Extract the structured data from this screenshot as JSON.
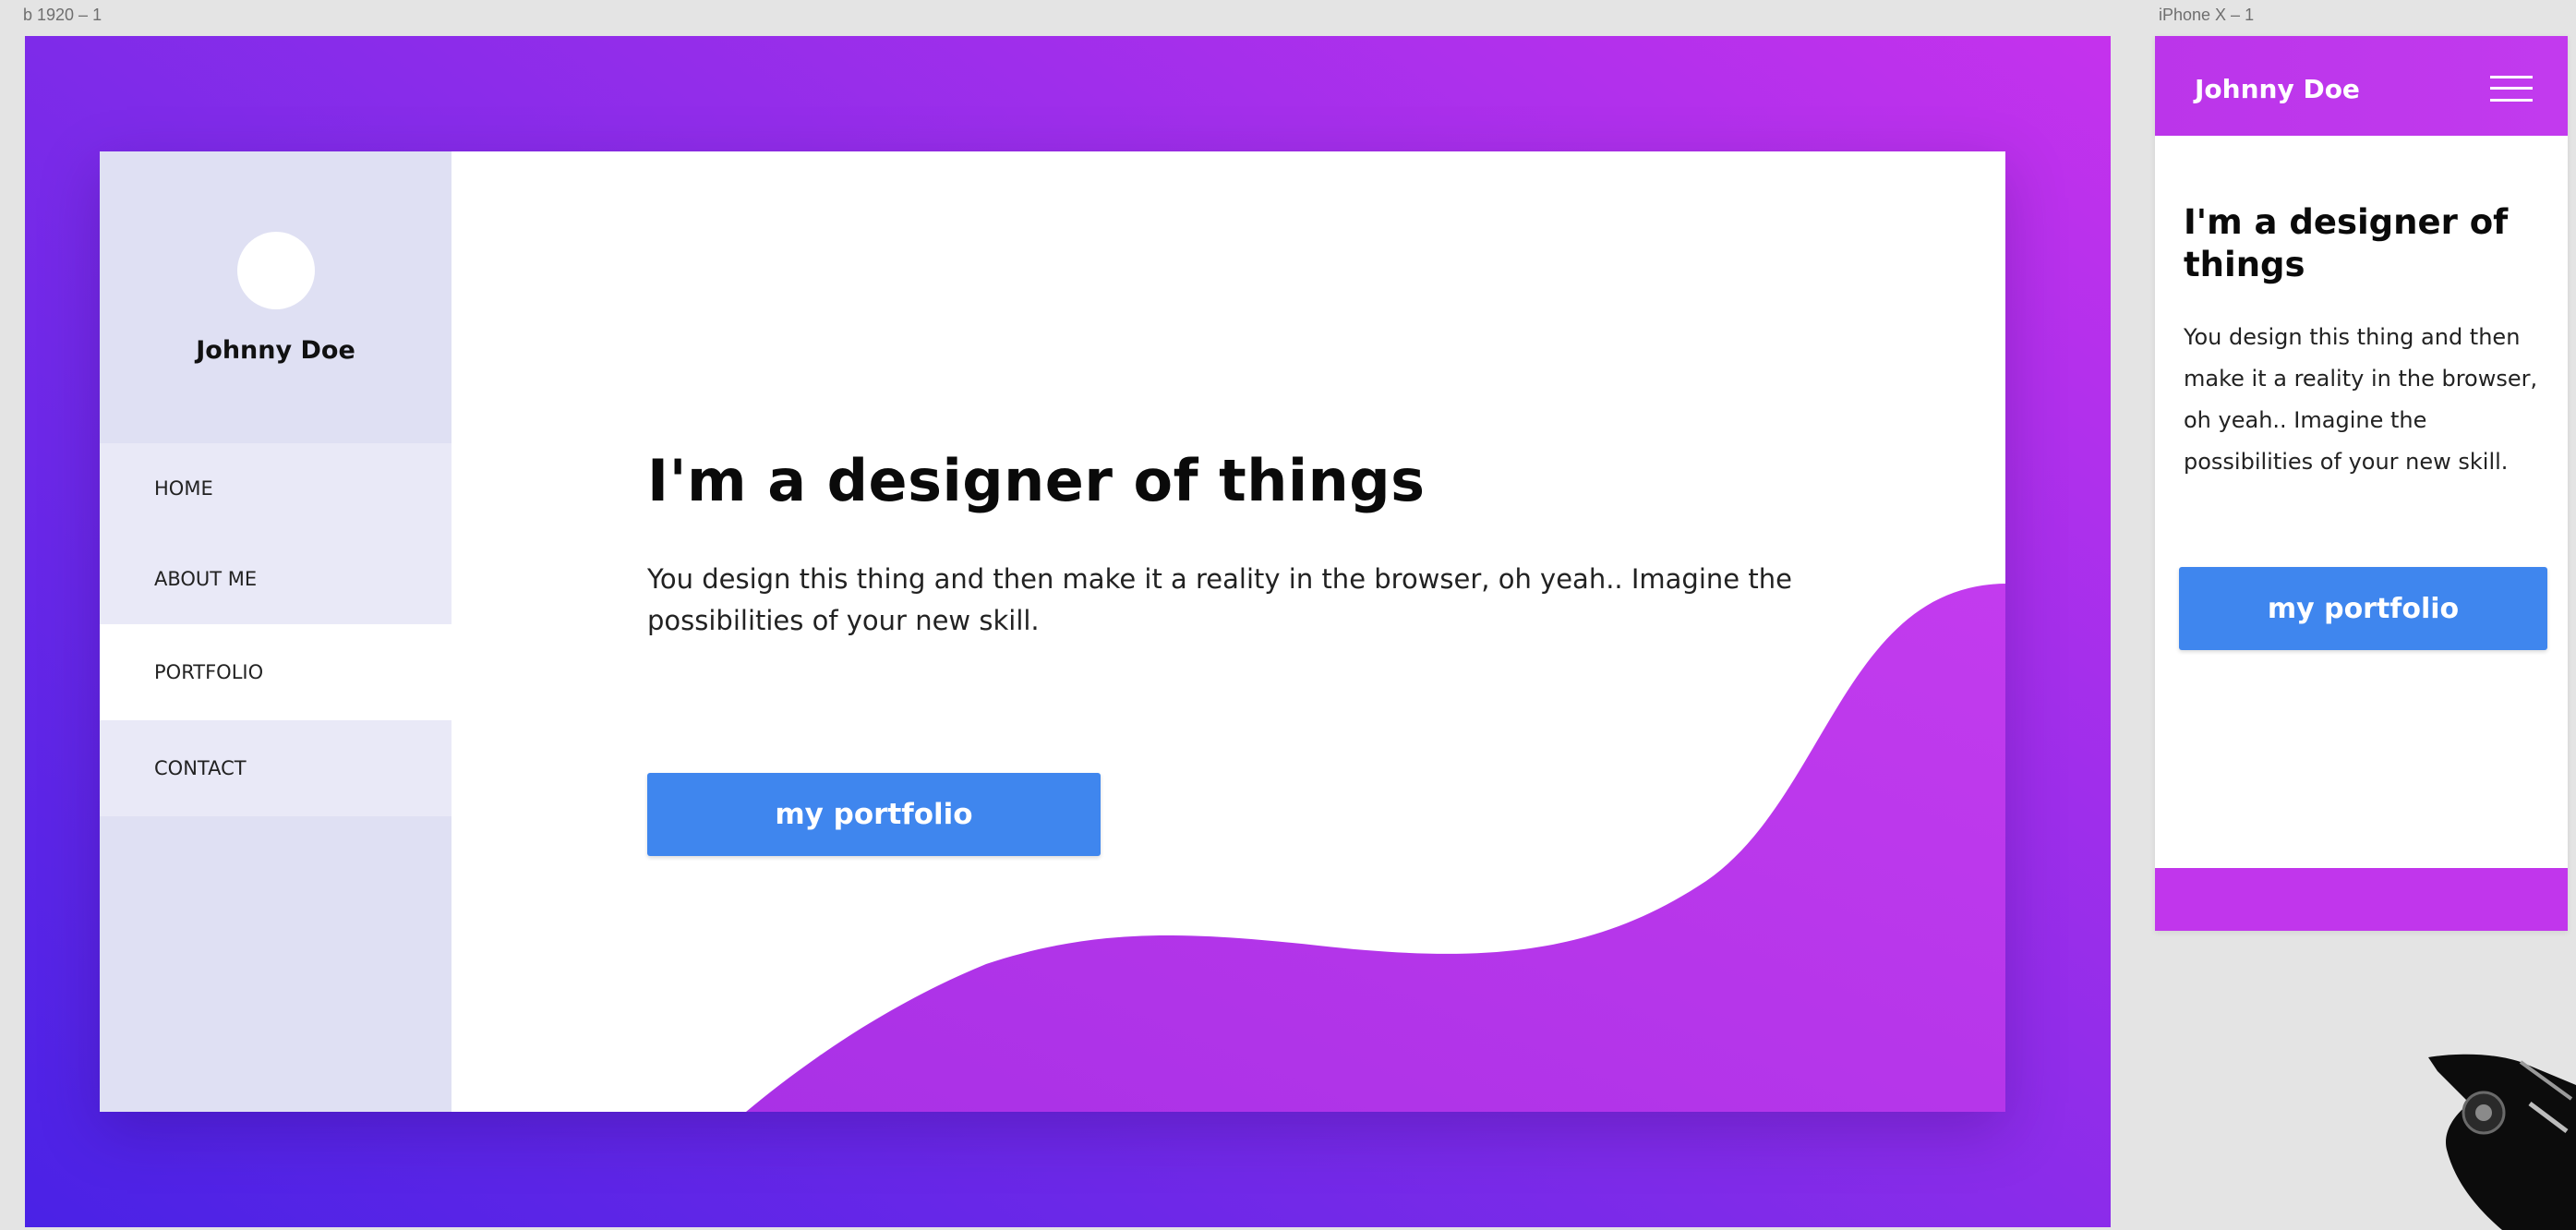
{
  "artboards": {
    "desktop_label": "b 1920 – 1",
    "mobile_label": "iPhone X – 1"
  },
  "desktop": {
    "profile_name": "Johnny Doe",
    "nav": [
      {
        "label": "HOME",
        "active": false
      },
      {
        "label": "ABOUT ME",
        "active": false
      },
      {
        "label": "PORTFOLIO",
        "active": true
      },
      {
        "label": "CONTACT",
        "active": false
      }
    ],
    "title": "I'm a designer of things",
    "description": "You design this thing and then make it a reality in the browser, oh yeah.. Imagine the possibilities of your new skill.",
    "cta_label": "my portfolio"
  },
  "mobile": {
    "brand": "Johnny Doe",
    "title": "I'm a designer of things",
    "description": "You design this thing and then make it a reality in the browser, oh yeah.. Imagine the possibilities of your new skill.",
    "cta_label": "my portfolio",
    "menu_icon": "hamburger-icon"
  },
  "colors": {
    "gradient_start": "#4a22e6",
    "gradient_end": "#c532ed",
    "accent_purple": "#c136ec",
    "button_blue": "#3f86ee",
    "sidebar_bg": "#dfe0f3"
  }
}
